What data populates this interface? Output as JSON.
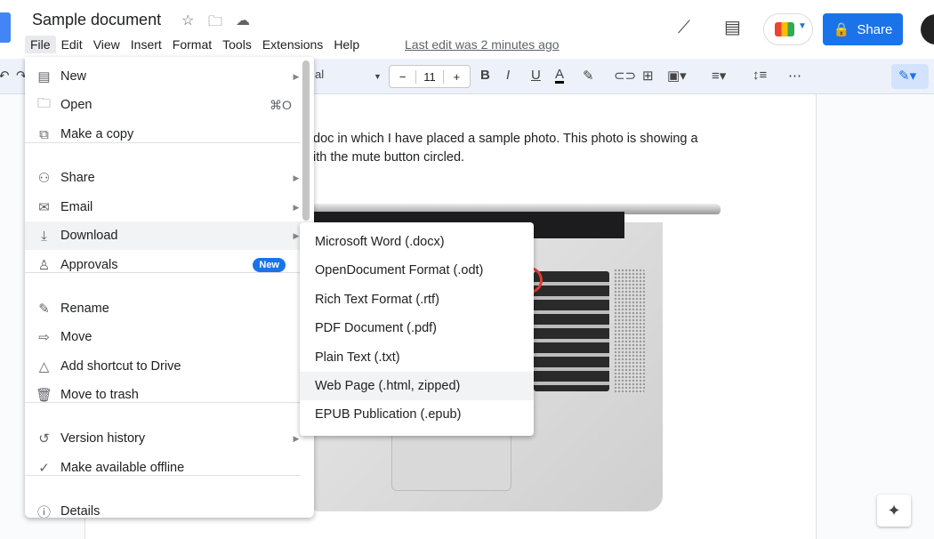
{
  "header": {
    "title": "Sample document",
    "last_edit": "Last edit was 2 minutes ago",
    "share_label": "Share",
    "menus": [
      "File",
      "Edit",
      "View",
      "Insert",
      "Format",
      "Tools",
      "Extensions",
      "Help"
    ]
  },
  "toolbar": {
    "font_partial": "al",
    "font_size": "11",
    "minus": "−",
    "plus": "+"
  },
  "document": {
    "line1": "doc in which I have placed a sample photo. This photo is showing a",
    "line2": "ith the mute button circled."
  },
  "file_menu": {
    "items": [
      {
        "label": "New",
        "icon": "document-icon",
        "glyph": "▤",
        "arrow": true
      },
      {
        "label": "Open",
        "icon": "folder-icon",
        "glyph": "🗀",
        "shortcut": "⌘O"
      },
      {
        "label": "Make a copy",
        "icon": "copy-icon",
        "glyph": "⧉"
      },
      {
        "label": "Share",
        "icon": "person-add-icon",
        "glyph": "⚇",
        "arrow": true
      },
      {
        "label": "Email",
        "icon": "email-icon",
        "glyph": "✉",
        "arrow": true
      },
      {
        "label": "Download",
        "icon": "download-icon",
        "glyph": "⤓",
        "arrow": true
      },
      {
        "label": "Approvals",
        "icon": "approvals-icon",
        "glyph": "♙",
        "badge": "New"
      },
      {
        "label": "Rename",
        "icon": "rename-icon",
        "glyph": "✎"
      },
      {
        "label": "Move",
        "icon": "move-icon",
        "glyph": "⇨"
      },
      {
        "label": "Add shortcut to Drive",
        "icon": "drive-shortcut-icon",
        "glyph": "△"
      },
      {
        "label": "Move to trash",
        "icon": "trash-icon",
        "glyph": "🗑"
      },
      {
        "label": "Version history",
        "icon": "history-icon",
        "glyph": "↺",
        "arrow": true
      },
      {
        "label": "Make available offline",
        "icon": "offline-icon",
        "glyph": "✓"
      },
      {
        "label": "Details",
        "icon": "info-icon",
        "glyph": "ⓘ"
      }
    ]
  },
  "download_menu": {
    "items": [
      "Microsoft Word (.docx)",
      "OpenDocument Format (.odt)",
      "Rich Text Format (.rtf)",
      "PDF Document (.pdf)",
      "Plain Text (.txt)",
      "Web Page (.html, zipped)",
      "EPUB Publication (.epub)"
    ],
    "highlighted": "Web Page (.html, zipped)"
  },
  "colors": {
    "accent": "#1a73e8",
    "mute_circle": "#e53935"
  }
}
